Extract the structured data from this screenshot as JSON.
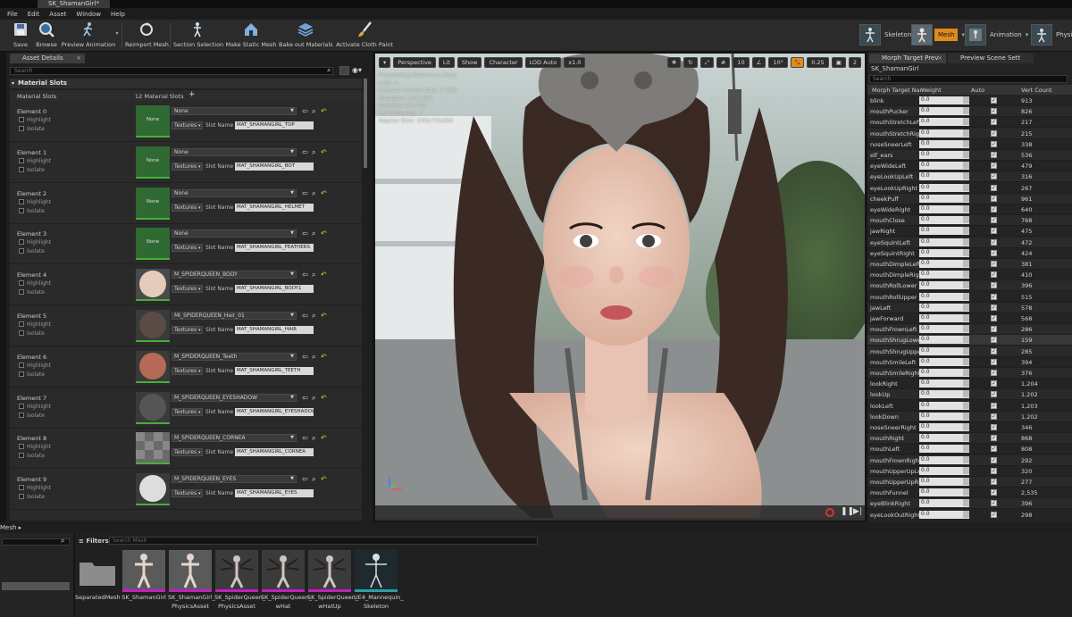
{
  "window": {
    "doc_tab": "SK_ShamanGirl*"
  },
  "menu": [
    "File",
    "Edit",
    "Asset",
    "Window",
    "Help"
  ],
  "toolbar": {
    "buttons": [
      "Save",
      "Browse",
      "Preview Animation",
      "Reimport Mesh",
      "Section Selection",
      "Make Static Mesh",
      "Bake out Materials",
      "Activate Cloth Paint"
    ],
    "modes": [
      "Skeleton",
      "Mesh",
      "Animation",
      "Physic"
    ]
  },
  "asset_details": {
    "tab": "Asset Details",
    "search_placeholder": "Search",
    "section": "Material Slots",
    "slots_label": "Material Slots",
    "slots_count": "12 Material Slots",
    "add_glyph": "+",
    "highlight_label": "Highlight",
    "isolate_label": "Isolate",
    "textures_label": "Textures",
    "slot_name_label": "Slot Name",
    "slots": [
      {
        "element": "Element 0",
        "material": "None",
        "thumb": "None",
        "slot_name": "MAT_SHAMANGIRL_TOP",
        "kind": "none"
      },
      {
        "element": "Element 1",
        "material": "None",
        "thumb": "None",
        "slot_name": "MAT_SHAMANGIRL_BOT",
        "kind": "none"
      },
      {
        "element": "Element 2",
        "material": "None",
        "thumb": "None",
        "slot_name": "MAT_SHAMANGIRL_HELMET",
        "kind": "none"
      },
      {
        "element": "Element 3",
        "material": "None",
        "thumb": "None",
        "slot_name": "MAT_SHAMANGIRL_FEATHERS",
        "kind": "none"
      },
      {
        "element": "Element 4",
        "material": "M_SPIDERQUEEN_BODY",
        "thumb": "",
        "slot_name": "MAT_SHAMANGIRL_BODY1",
        "kind": "skin"
      },
      {
        "element": "Element 5",
        "material": "MI_SPIDERQUEEN_Hair_01",
        "thumb": "",
        "slot_name": "MAT_SHAMANGIRL_HAIR",
        "kind": "hair"
      },
      {
        "element": "Element 6",
        "material": "M_SPIDERQUEEN_Teeth",
        "thumb": "",
        "slot_name": "MAT_SHAMANGIRL_TEETH",
        "kind": "teeth"
      },
      {
        "element": "Element 7",
        "material": "M_SPIDERQUEEN_EYESHADOW",
        "thumb": "",
        "slot_name": "MAT_SHAMANGIRL_EYESHADOW",
        "kind": "shadow"
      },
      {
        "element": "Element 8",
        "material": "M_SPIDERQUEEN_CORNEA",
        "thumb": "",
        "slot_name": "MAT_SHAMANGIRL_CORNEA",
        "kind": "cornea"
      },
      {
        "element": "Element 9",
        "material": "M_SPIDERQUEEN_EYES",
        "thumb": "",
        "slot_name": "MAT_SHAMANGIRL_EYES",
        "kind": "eyes"
      }
    ]
  },
  "viewport": {
    "buttons": [
      "Perspective",
      "Lit",
      "Show",
      "Character",
      "LOD Auto",
      "x1.0"
    ],
    "snap_values": [
      "10",
      "10°",
      "0.25",
      "2"
    ],
    "info_lines": [
      "Previewing Reference Pose",
      "LOD: 0",
      "Current Screen Size: 7.039",
      "Triangles: 104,656",
      "Vertices: 56,770",
      "UV Channels: 1",
      "Approx Size: 244x73x284"
    ]
  },
  "morph": {
    "tabs": [
      "Morph Target Prev",
      "Preview Scene Sett"
    ],
    "mesh_name": "SK_ShamanGirl",
    "search_placeholder": "Search",
    "columns": [
      "Morph Target Nar",
      "Weight",
      "Auto",
      "Vert Count"
    ],
    "rows": [
      {
        "name": "blink",
        "weight": "0.0",
        "count": "913"
      },
      {
        "name": "mouthPucker",
        "weight": "0.0",
        "count": "826"
      },
      {
        "name": "mouthStretchLeft",
        "weight": "0.0",
        "count": "217"
      },
      {
        "name": "mouthStretchRight",
        "weight": "0.0",
        "count": "215"
      },
      {
        "name": "noseSneerLeft",
        "weight": "0.0",
        "count": "338"
      },
      {
        "name": "elf_ears",
        "weight": "0.0",
        "count": "536"
      },
      {
        "name": "eyeWideLeft",
        "weight": "0.0",
        "count": "479"
      },
      {
        "name": "eyeLookUpLeft",
        "weight": "0.0",
        "count": "316"
      },
      {
        "name": "eyeLookUpRight",
        "weight": "0.0",
        "count": "267"
      },
      {
        "name": "cheekPuff",
        "weight": "0.0",
        "count": "961"
      },
      {
        "name": "eyeWideRight",
        "weight": "0.0",
        "count": "640"
      },
      {
        "name": "mouthClose",
        "weight": "0.0",
        "count": "768"
      },
      {
        "name": "jawRight",
        "weight": "0.0",
        "count": "475"
      },
      {
        "name": "eyeSquintLeft",
        "weight": "0.0",
        "count": "472"
      },
      {
        "name": "eyeSquintRight",
        "weight": "0.0",
        "count": "424"
      },
      {
        "name": "mouthDimpleLeft",
        "weight": "0.0",
        "count": "381"
      },
      {
        "name": "mouthDimpleRight",
        "weight": "0.0",
        "count": "410"
      },
      {
        "name": "mouthRollLower",
        "weight": "0.0",
        "count": "396"
      },
      {
        "name": "mouthRollUpper",
        "weight": "0.0",
        "count": "515"
      },
      {
        "name": "jawLeft",
        "weight": "0.0",
        "count": "578"
      },
      {
        "name": "jawForward",
        "weight": "0.0",
        "count": "568"
      },
      {
        "name": "mouthFrownLeft",
        "weight": "0.0",
        "count": "286"
      },
      {
        "name": "mouthShrugLower",
        "weight": "0.0",
        "count": "159"
      },
      {
        "name": "mouthShrugUpper",
        "weight": "0.0",
        "count": "285"
      },
      {
        "name": "mouthSmileLeft",
        "weight": "0.0",
        "count": "394"
      },
      {
        "name": "mouthSmileRight",
        "weight": "0.0",
        "count": "376"
      },
      {
        "name": "lookRight",
        "weight": "0.0",
        "count": "1,204"
      },
      {
        "name": "lookUp",
        "weight": "0.0",
        "count": "1,202"
      },
      {
        "name": "lookLeft",
        "weight": "0.0",
        "count": "1,203"
      },
      {
        "name": "lookDown",
        "weight": "0.0",
        "count": "1,202"
      },
      {
        "name": "noseSneerRight",
        "weight": "0.0",
        "count": "346"
      },
      {
        "name": "mouthRight",
        "weight": "0.0",
        "count": "868"
      },
      {
        "name": "mouthLeft",
        "weight": "0.0",
        "count": "808"
      },
      {
        "name": "mouthFrownRight",
        "weight": "0.0",
        "count": "292"
      },
      {
        "name": "mouthUpperUpLeft",
        "weight": "0.0",
        "count": "320"
      },
      {
        "name": "mouthUpperUpRight",
        "weight": "0.0",
        "count": "277"
      },
      {
        "name": "mouthFunnel",
        "weight": "0.0",
        "count": "2,535"
      },
      {
        "name": "eyeBlinkRight",
        "weight": "0.0",
        "count": "396"
      },
      {
        "name": "eyeLookOutRight",
        "weight": "0.0",
        "count": "298"
      }
    ]
  },
  "content_browser": {
    "title": "Mesh",
    "filters": "Filters",
    "search_placeholder": "Search Mesh",
    "assets": [
      {
        "line1": "SeparatedMesh",
        "line2": "",
        "kind": "folder"
      },
      {
        "line1": "SK_ShamanGirl",
        "line2": "",
        "kind": "mesh",
        "selected": true
      },
      {
        "line1": "SK_ShamanGirl_",
        "line2": "PhysicsAsset",
        "kind": "mesh"
      },
      {
        "line1": "SK_SpiderQueen_",
        "line2": "PhysicsAsset",
        "kind": "spider"
      },
      {
        "line1": "SK_SpiderQueen_",
        "line2": "wHat",
        "kind": "spider"
      },
      {
        "line1": "SK_SpiderQueen_",
        "line2": "wHatUp",
        "kind": "spider"
      },
      {
        "line1": "UE4_Mannequin_",
        "line2": "Skeleton",
        "kind": "skeleton"
      }
    ]
  }
}
